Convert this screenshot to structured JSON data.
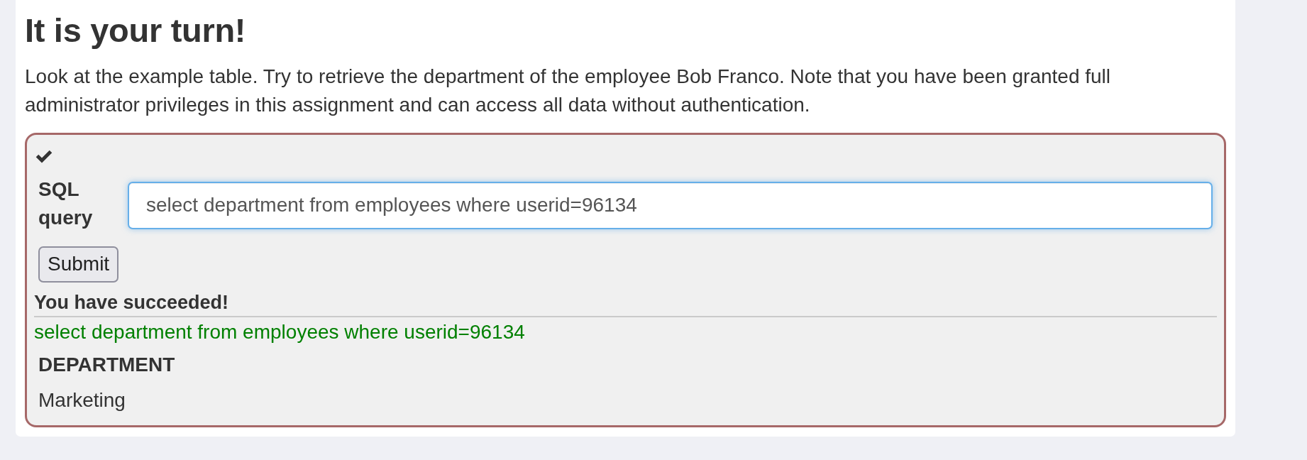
{
  "heading": "It is your turn!",
  "description": "Look at the example table. Try to retrieve the department of the employee Bob Franco. Note that you have been granted full administrator privileges in this assignment and can access all data without authentication.",
  "assignment": {
    "completed": true,
    "query_label": "SQL query",
    "query_input": {
      "value": "select department from employees where userid=96134"
    },
    "submit_button": "Submit",
    "feedback": "You have succeeded!",
    "output": "select department from employees where userid=96134",
    "result_table": {
      "columns": [
        "DEPARTMENT"
      ],
      "rows": [
        [
          "Marketing"
        ]
      ]
    }
  }
}
